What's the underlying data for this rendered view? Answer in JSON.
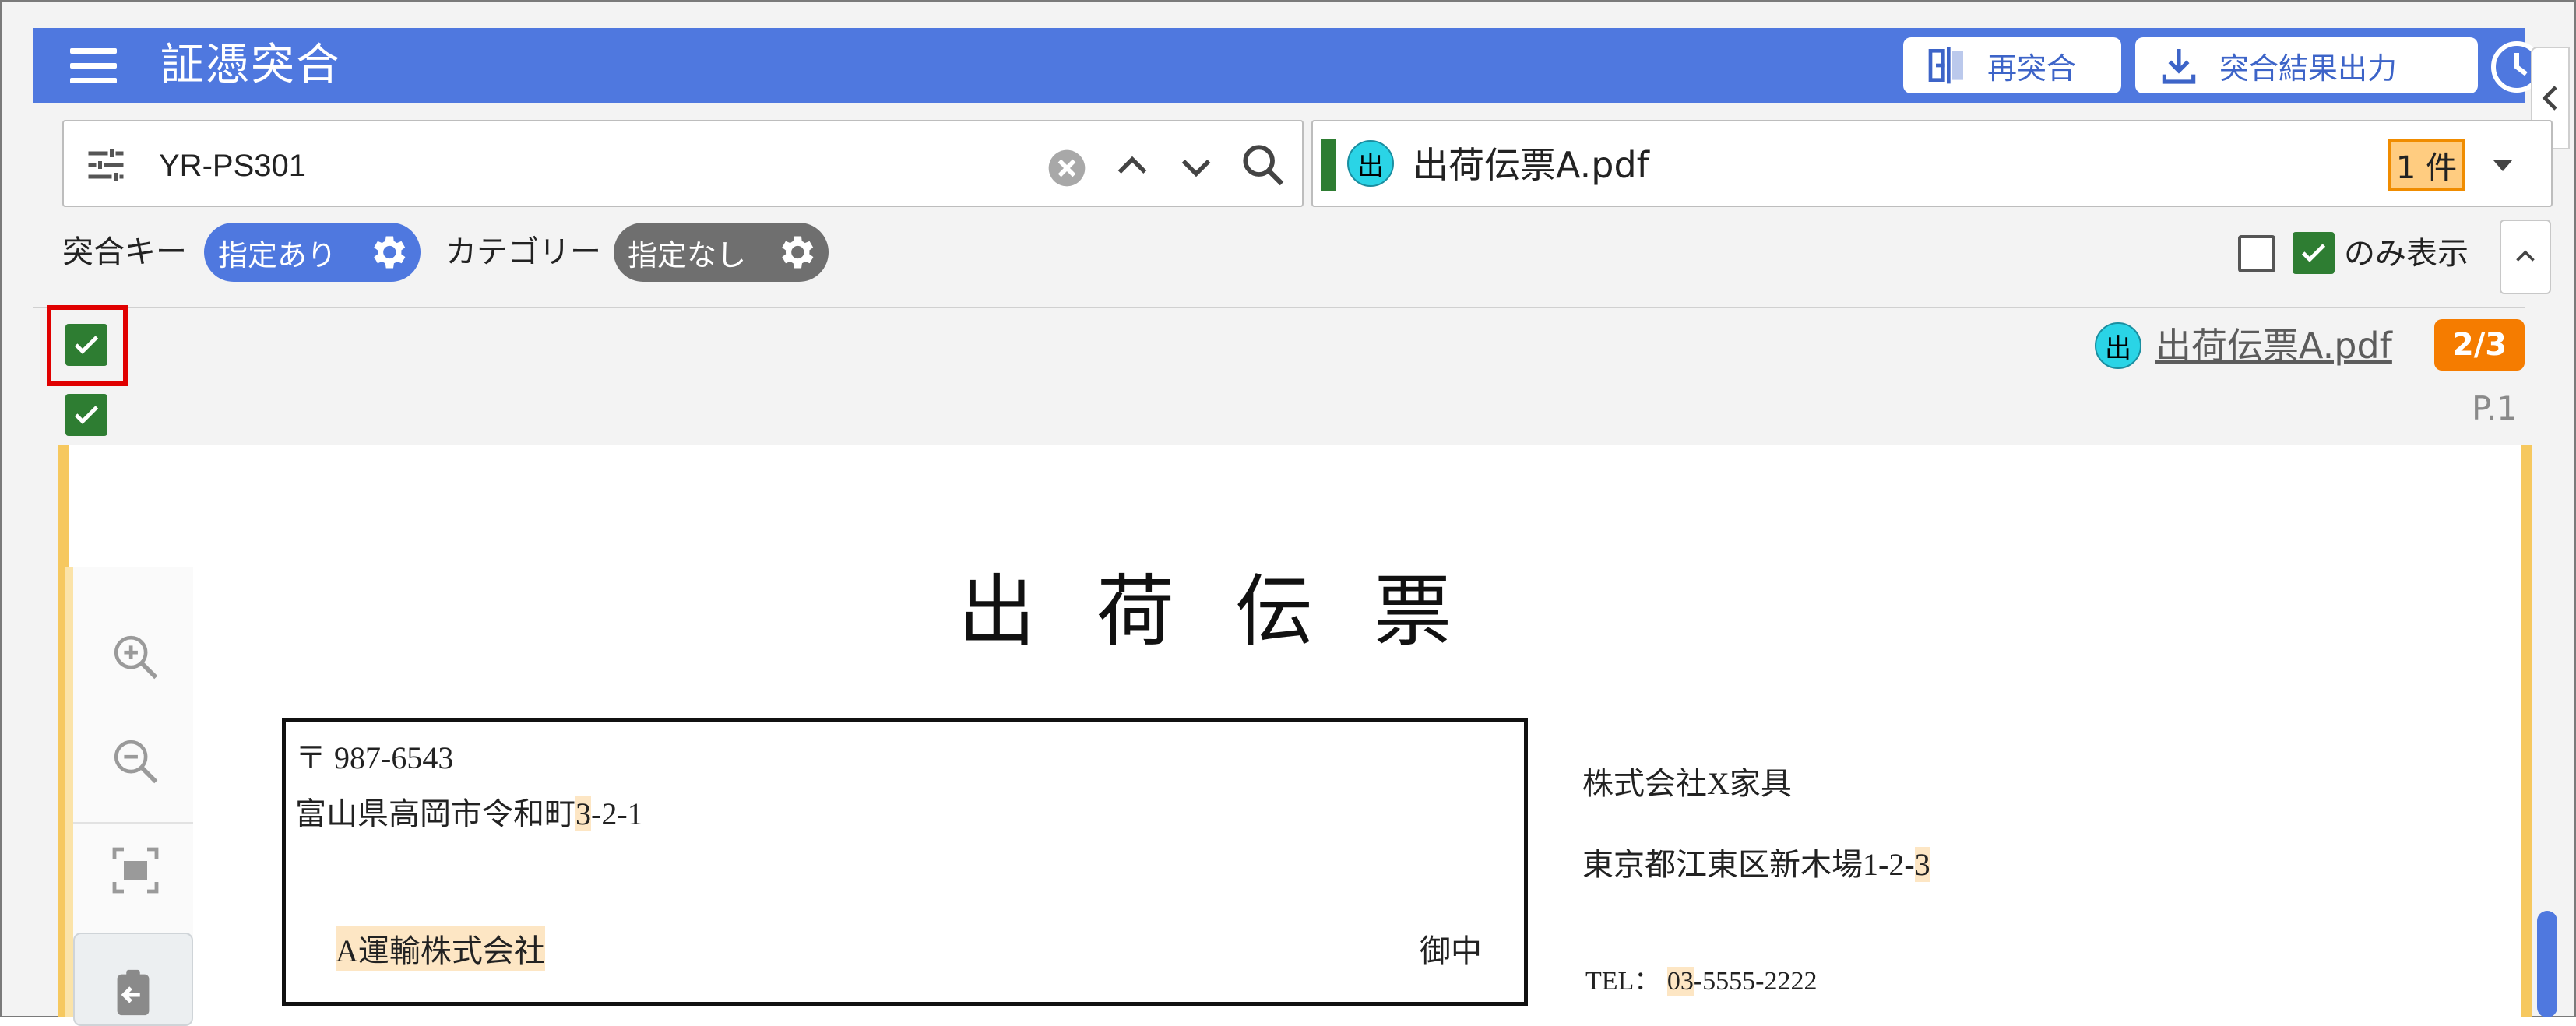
{
  "header": {
    "app_title": "証憑突合",
    "rematch_label": "再突合",
    "export_label": "突合結果出力",
    "accent": "#4f78df"
  },
  "search": {
    "value": "YR-PS301"
  },
  "doc_selector": {
    "badge": "出",
    "doc_name": "出荷伝票A.pdf",
    "count": "1 件"
  },
  "filters": {
    "match_key_label": "突合キー",
    "match_key_state": "指定あり",
    "category_label": "カテゴリー",
    "category_state": "指定なし",
    "only_show_label": "のみ表示"
  },
  "result": {
    "badge": "出",
    "doc_link": "出荷伝票A.pdf",
    "page_badge": "2/3",
    "page_number": "P.1"
  },
  "document": {
    "title": "出荷伝票",
    "postal": "〒 987-6543",
    "addr_pre": "富山県高岡市令和町",
    "addr_hl": "3",
    "addr_post": "-2-1",
    "recipient": "A運輸株式会社",
    "honorific": "御中",
    "company": "株式会社X家具",
    "sender_addr_pre": "東京都江東区新木場1-2-",
    "sender_addr_hl": "3",
    "tel_label": "TEL：",
    "tel_hl": "03",
    "tel_rest": "-5555-2222"
  }
}
